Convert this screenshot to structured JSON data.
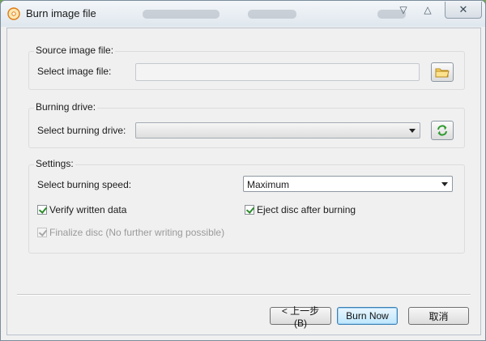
{
  "window": {
    "title": "Burn image file",
    "close_symbol": "✕",
    "controls": {
      "minimize_symbol": "▽",
      "maximize_symbol": "△"
    }
  },
  "source_group": {
    "title": "Source image file:",
    "label": "Select image file:",
    "value": "",
    "browse_icon": "folder-icon"
  },
  "drive_group": {
    "title": "Burning drive:",
    "label": "Select burning drive:",
    "selected": "",
    "refresh_icon": "refresh-icon"
  },
  "settings_group": {
    "title": "Settings:",
    "speed_label": "Select burning speed:",
    "speed_value": "Maximum",
    "verify_label": "Verify written data",
    "verify_checked": true,
    "eject_label": "Eject disc after burning",
    "eject_checked": true,
    "finalize_label": "Finalize disc (No further writing possible)",
    "finalize_checked": true,
    "finalize_disabled": true
  },
  "footer": {
    "back_label": "< 上一步(B)",
    "burn_label": "Burn Now",
    "cancel_label": "取消"
  },
  "colors": {
    "accent": "#3c7fb1",
    "checkmark": "#2a8a2a",
    "desktop_green": "#7fbf5a"
  }
}
